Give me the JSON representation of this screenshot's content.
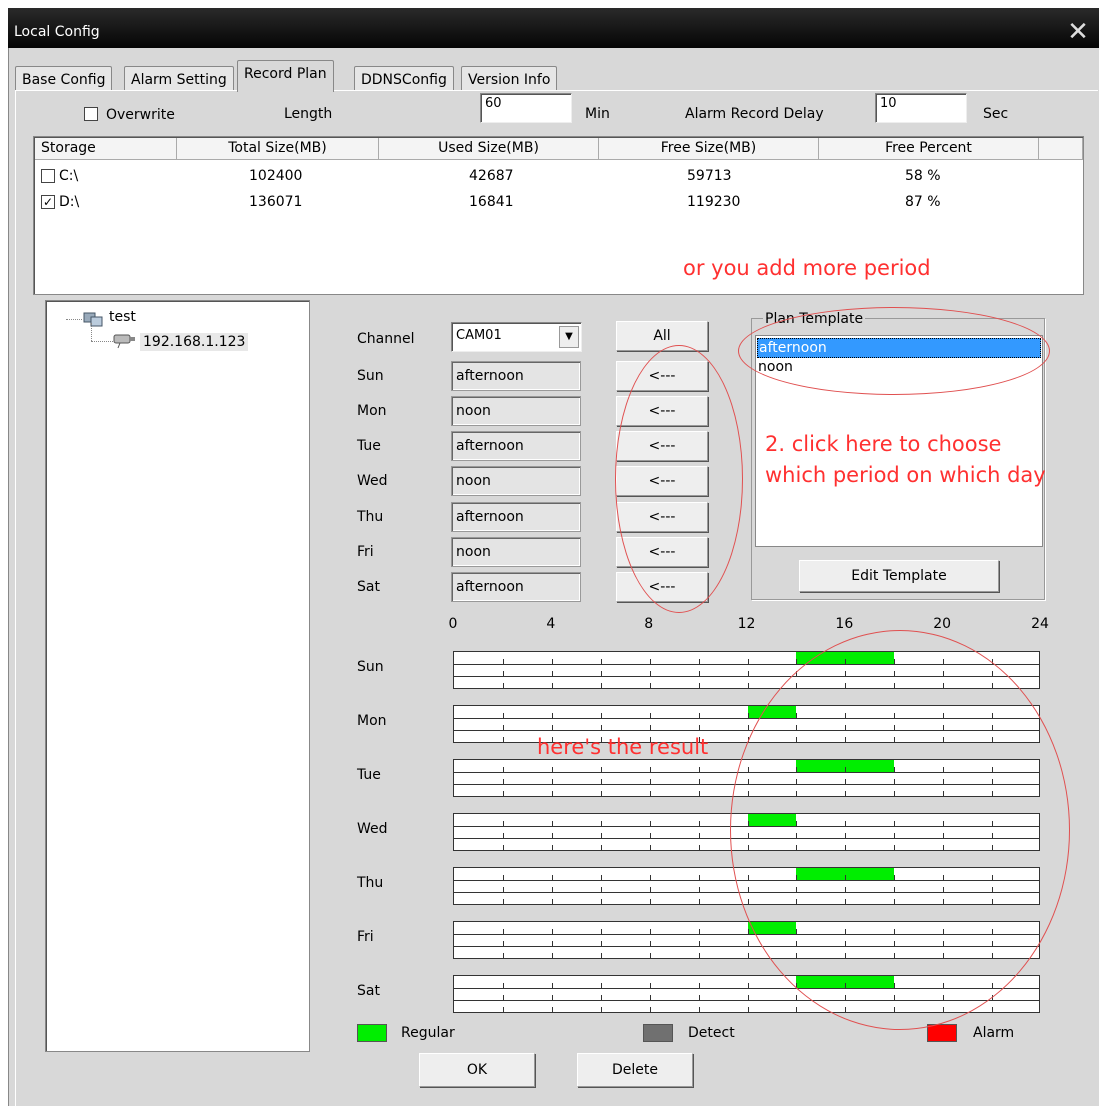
{
  "window": {
    "title": "Local Config",
    "close_glyph": "✕"
  },
  "tabs": [
    {
      "label": "Base Config"
    },
    {
      "label": "Alarm Setting"
    },
    {
      "label": "Record Plan"
    },
    {
      "label": "DDNSConfig"
    },
    {
      "label": "Version Info"
    }
  ],
  "settings": {
    "overwrite_label": "Overwrite",
    "overwrite_checked": false,
    "length_label": "Length",
    "length_value": "60",
    "length_unit": "Min",
    "alarm_delay_label": "Alarm Record Delay",
    "alarm_delay_value": "10",
    "alarm_delay_unit": "Sec"
  },
  "storage": {
    "columns": [
      "Storage",
      "Total Size(MB)",
      "Used Size(MB)",
      "Free Size(MB)",
      "Free Percent"
    ],
    "rows": [
      {
        "drive": "C:\\",
        "checked": false,
        "total": "102400",
        "used": "42687",
        "free": "59713",
        "percent": "58 %"
      },
      {
        "drive": "D:\\",
        "checked": true,
        "total": "136071",
        "used": "16841",
        "free": "119230",
        "percent": "87 %"
      }
    ]
  },
  "tree": {
    "root": "test",
    "child": "192.168.1.123"
  },
  "channel": {
    "label": "Channel",
    "value": "CAM01",
    "all_button": "All"
  },
  "days": [
    {
      "day": "Sun",
      "plan": "afternoon"
    },
    {
      "day": "Mon",
      "plan": "noon"
    },
    {
      "day": "Tue",
      "plan": "afternoon"
    },
    {
      "day": "Wed",
      "plan": "noon"
    },
    {
      "day": "Thu",
      "plan": "afternoon"
    },
    {
      "day": "Fri",
      "plan": "noon"
    },
    {
      "day": "Sat",
      "plan": "afternoon"
    }
  ],
  "assign_button": "<---",
  "plan_template": {
    "group_label": "Plan Template",
    "items": [
      "afternoon",
      "noon"
    ],
    "selected": "afternoon",
    "edit_button": "Edit Template"
  },
  "timeline": {
    "ticks": [
      "0",
      "4",
      "8",
      "12",
      "16",
      "20",
      "24"
    ],
    "periods": {
      "afternoon": [
        14,
        18
      ],
      "noon": [
        12,
        14
      ]
    }
  },
  "legend": [
    {
      "label": "Regular",
      "color": "#00ee00"
    },
    {
      "label": "Detect",
      "color": "#707070"
    },
    {
      "label": "Alarm",
      "color": "#ff0000"
    }
  ],
  "buttons": {
    "ok": "OK",
    "delete": "Delete"
  },
  "annotations": {
    "more_period": "or you add more period",
    "choose": "2. click here to choose",
    "choose2": "which period on which day",
    "result": "here's the result"
  }
}
